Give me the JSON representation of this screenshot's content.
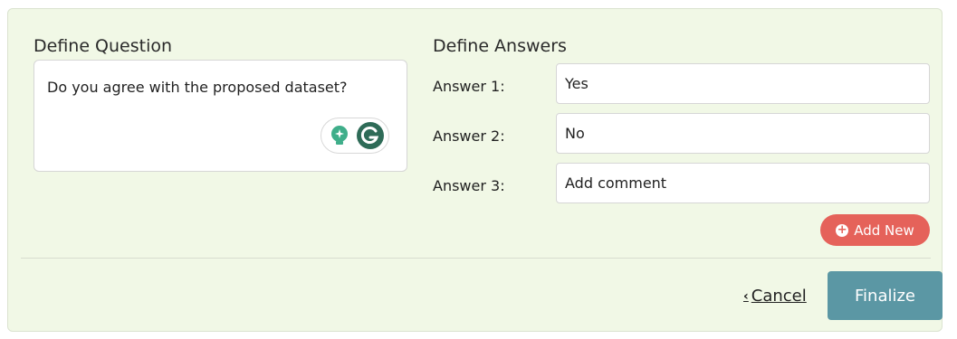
{
  "question": {
    "title": "Define Question",
    "text": "Do you agree with the proposed dataset?"
  },
  "answers": {
    "title": "Define Answers",
    "items": [
      {
        "label": "Answer 1:",
        "value": "Yes"
      },
      {
        "label": "Answer 2:",
        "value": "No"
      },
      {
        "label": "Answer 3:",
        "value": "Add comment"
      }
    ],
    "add_new_label": "Add New"
  },
  "footer": {
    "cancel_label": "Cancel",
    "finalize_label": "Finalize"
  },
  "colors": {
    "panel_bg": "#f1f8e6",
    "add_new": "#e5625a",
    "finalize": "#5b97a4",
    "grammarly_green": "#15c39a",
    "grammarly_dark": "#2e6b57"
  },
  "icons": [
    "lightbulb-icon",
    "grammarly-icon",
    "plus-circle-icon",
    "chevron-left-icon"
  ]
}
